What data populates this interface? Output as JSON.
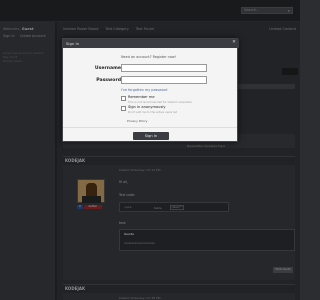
{
  "topbar": {
    "search_placeholder": "Search..."
  },
  "sidebar": {
    "welcome_prefix": "Welcome,",
    "welcome_name": "Guest",
    "links": [
      "Sign In",
      "Create Account"
    ],
    "meta": [
      "Lorem ipsum forum section",
      "Tag cloud",
      "Online users"
    ]
  },
  "main": {
    "breadcrumbs": [
      "Invision Power Board",
      "Test Category",
      "Test Forum"
    ],
    "crumbs_right": "Unread Content",
    "update_label": "Newsletter Updated Topic",
    "posts": [
      {
        "author": "KODEJAK",
        "time": "Posted Yesterday, 07:32 PM",
        "rank_short": "0",
        "rank_label": "Author",
        "text_a": "Hi all,",
        "text_b": "Test code:",
        "code_key": "<pre",
        "code_val": "table",
        "code_tag": "class=\"\"",
        "text_c": "test:",
        "quote_label": "Quote",
        "quote_text": "xxxxxxxxxxxxxxxxxxxx",
        "reply_label": "Multi-Quote"
      },
      {
        "author": "KODEJAK",
        "time": "Posted Yesterday, 07:38 PM"
      }
    ]
  },
  "modal": {
    "title": "Sign In",
    "register_text": "Need an account? Register now!",
    "username_label": "Username",
    "password_label": "Password",
    "forgot_text": "I've forgotten my password",
    "remember_label": "Remember me",
    "remember_desc": "This is not recommended for shared computers",
    "anon_label": "Sign in anonymously",
    "anon_desc": "Don't add me to the active users list",
    "privacy_text": "Privacy Policy",
    "signin_label": "Sign In"
  }
}
